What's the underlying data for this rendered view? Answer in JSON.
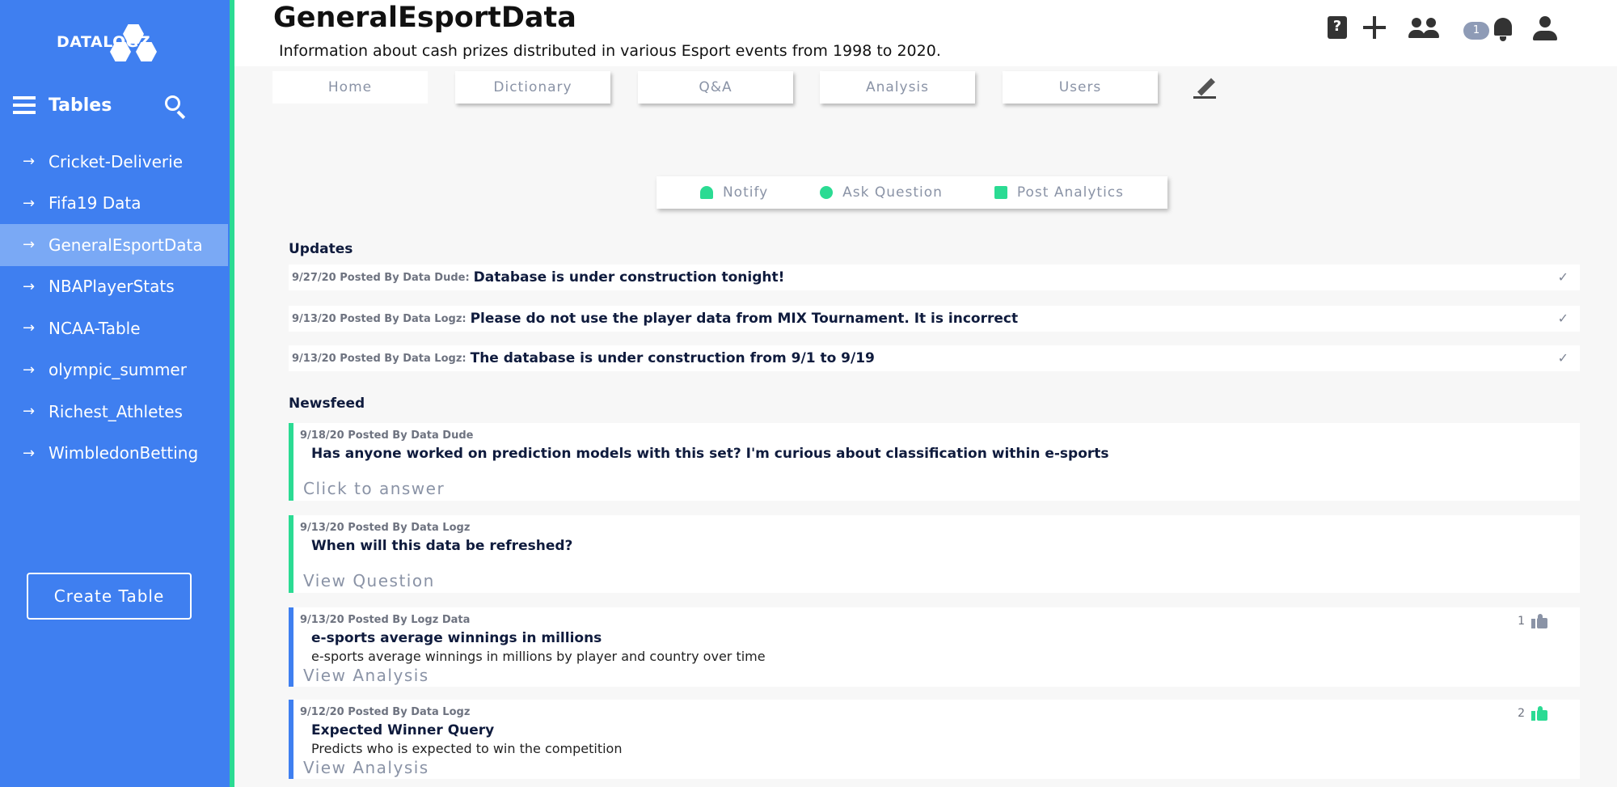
{
  "brand": {
    "logo_text": "DATALOGZ"
  },
  "sidebar": {
    "tables_label": "Tables",
    "items": [
      {
        "label": "Cricket-Deliverie"
      },
      {
        "label": "Fifa19 Data"
      },
      {
        "label": "GeneralEsportData",
        "active": true
      },
      {
        "label": "NBAPlayerStats"
      },
      {
        "label": "NCAA-Table"
      },
      {
        "label": "olympic_summer"
      },
      {
        "label": "Richest_Athletes"
      },
      {
        "label": "WimbledonBetting"
      }
    ],
    "create_button": "Create Table"
  },
  "header": {
    "title": "GeneralEsportData",
    "subtitle": "Information about cash prizes distributed in various Esport events from 1998 to 2020.",
    "notification_count": "1",
    "icons": [
      "help-icon",
      "plus-icon",
      "group-icon",
      "bell-icon",
      "person-icon"
    ]
  },
  "tabs": [
    {
      "label": "Home"
    },
    {
      "label": "Dictionary"
    },
    {
      "label": "Q&A"
    },
    {
      "label": "Analysis"
    },
    {
      "label": "Users"
    }
  ],
  "actions": [
    {
      "label": "Notify",
      "icon": "notify-icon"
    },
    {
      "label": "Ask Question",
      "icon": "bulb-icon"
    },
    {
      "label": "Post Analytics",
      "icon": "library-icon"
    }
  ],
  "updates": {
    "title": "Updates",
    "items": [
      {
        "meta": "9/27/20 Posted By Data Dude:",
        "message": "Database is under construction tonight!"
      },
      {
        "meta": "9/13/20 Posted By Data Logz:",
        "message": "Please do not use the  player data from MIX Tournament. It is incorrect"
      },
      {
        "meta": "9/13/20 Posted By Data Logz:",
        "message": "The database is under construction from 9/1 to 9/19"
      }
    ]
  },
  "newsfeed": {
    "title": "Newsfeed",
    "items": [
      {
        "meta": "9/18/20 Posted By Data Dude",
        "title": "Has anyone worked on prediction models with this set? I'm curious about classification within e-sports",
        "link": "Click to answer"
      },
      {
        "meta": "9/13/20 Posted By Data Logz",
        "title": "When will this data be refreshed?",
        "link": "View Question"
      },
      {
        "meta": "9/13/20 Posted By Logz Data",
        "title": "e-sports average winnings in millions",
        "description": "e-sports average winnings in millions by player and country over time",
        "link": "View Analysis",
        "likes": "1"
      },
      {
        "meta": "9/12/20 Posted By Data Logz",
        "title": "Expected Winner Query",
        "description": "Predicts who is expected to win the competition",
        "link": "View Analysis",
        "likes": "2"
      }
    ]
  },
  "colors": {
    "sidebar": "#3f7ff0",
    "accent": "#2bdb93",
    "active_item": "#7aa9f5",
    "thumb_gray": "#8a93a6",
    "thumb_green": "#2bdb93"
  }
}
